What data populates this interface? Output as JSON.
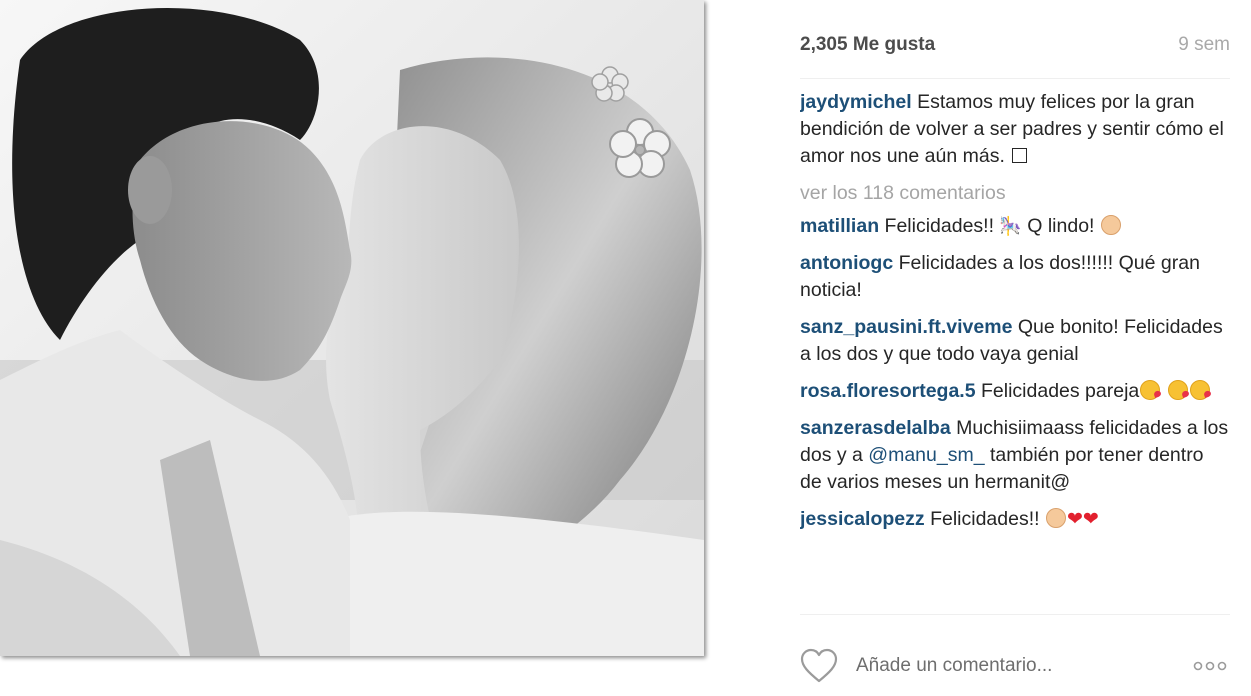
{
  "post": {
    "image_icon": "photo-couple-kissing",
    "likes": "2,305 Me gusta",
    "age": "9 sem",
    "caption": {
      "username": "jaydymichel",
      "text": "Estamos muy felices por la gran bendición de volver a ser padres y sentir cómo el amor nos une aún más."
    },
    "view_all_comments": "ver los 118 comentarios",
    "comments": [
      {
        "username": "matillian",
        "text_1": "Felicidades!!",
        "text_2": "Q lindo!"
      },
      {
        "username": "antoniogc",
        "text": "Felicidades a los dos!!!!!! Qué gran noticia!"
      },
      {
        "username": "sanz_pausini.ft.viveme",
        "text": "Que bonito! Felicidades a los dos y que todo vaya genial"
      },
      {
        "username": "rosa.floresortega.5",
        "text": "Felicidades pareja"
      },
      {
        "username": "sanzerasdelalba",
        "text_1": "Muchisiimaass felicidades a los dos y a",
        "mention": "@manu_sm_",
        "text_2": "también por tener dentro de varios meses un hermanit@"
      },
      {
        "username": "jessicalopezz",
        "text": "Felicidades!!"
      }
    ],
    "add_comment_placeholder": "Añade un comentario...",
    "colors": {
      "username": "#1d4f77",
      "muted": "#a9a9a9",
      "heart_emoji": "#e2202e"
    }
  }
}
